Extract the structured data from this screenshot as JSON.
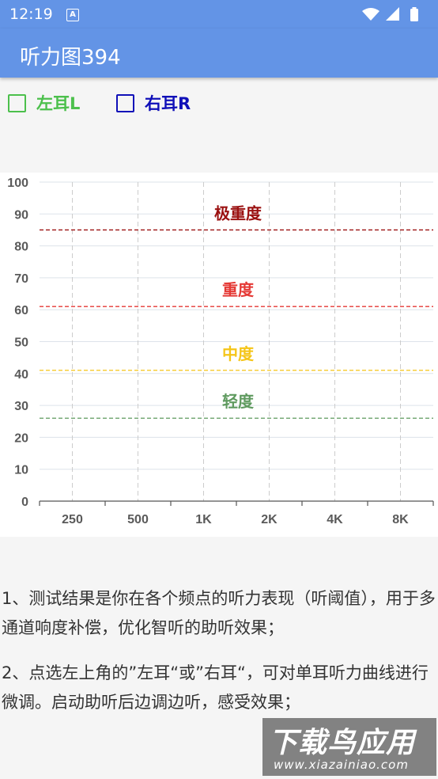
{
  "status_bar": {
    "time": "12:19",
    "notification_icon": "A"
  },
  "app_bar": {
    "title": "听力图394"
  },
  "ear_selector": {
    "left_label": "左耳L",
    "right_label": "右耳R",
    "left_color": "#4cc04c",
    "right_color": "#1010b8"
  },
  "chart_data": {
    "type": "line",
    "title": "",
    "xlabel": "",
    "ylabel": "",
    "categories": [
      "250",
      "500",
      "1K",
      "2K",
      "4K",
      "8K"
    ],
    "ylim": [
      0,
      100
    ],
    "yticks": [
      0,
      10,
      20,
      30,
      40,
      50,
      60,
      70,
      80,
      90,
      100
    ],
    "grid": true,
    "series": [],
    "thresholds": [
      {
        "label": "轻度",
        "value": 26,
        "color": "#5f9a5f"
      },
      {
        "label": "中度",
        "value": 41,
        "color": "#f5c518"
      },
      {
        "label": "重度",
        "value": 61,
        "color": "#e53935"
      },
      {
        "label": "极重度",
        "value": 85,
        "color": "#9b1111"
      }
    ]
  },
  "description": {
    "p1": "1、测试结果是你在各个频点的听力表现（听阈值），用于多通道响度补偿，优化智听的助听效果；",
    "p2": "2、点选左上角的”左耳“或”右耳“，可对单耳听力曲线进行微调。启动助听后边调边听，感受效果；"
  },
  "watermark": {
    "main": "下载鸟应用",
    "sub": "www.xiazainiao.com"
  }
}
